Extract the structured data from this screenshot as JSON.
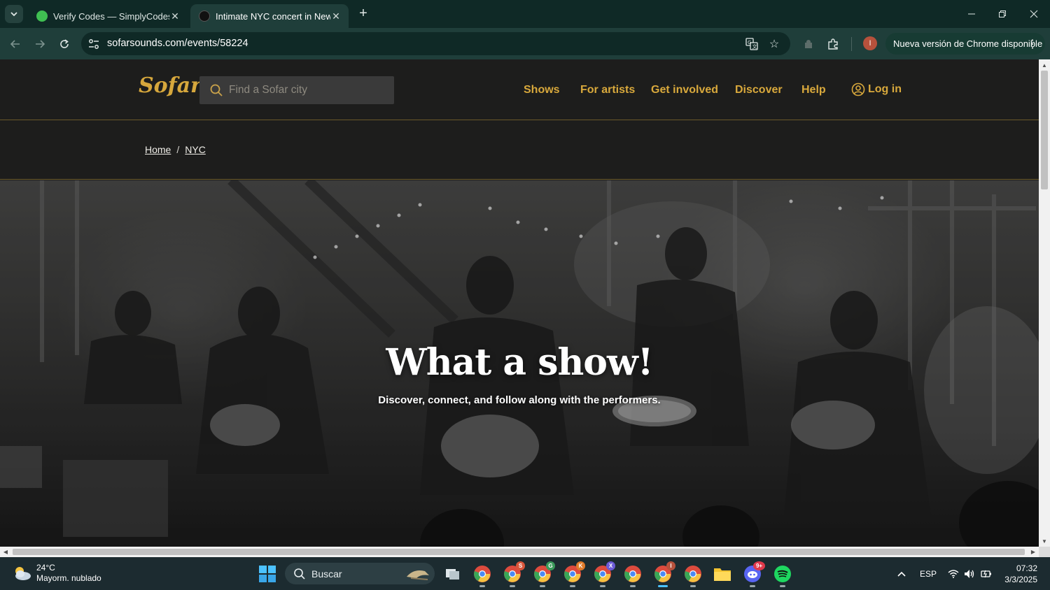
{
  "browser": {
    "tabs": [
      {
        "title": "Verify Codes — SimplyCodes",
        "active": false,
        "favicon_color": "#3fbf52"
      },
      {
        "title": "Intimate NYC concert in Newark",
        "active": true,
        "favicon_color": "#1a1a1a"
      }
    ],
    "url": "sofarsounds.com/events/58224",
    "profile_initial": "I",
    "update_label": "Nueva versión de Chrome disponible"
  },
  "site": {
    "logo": "Sofar",
    "search_placeholder": "Find a Sofar city",
    "nav": [
      "Shows",
      "For artists",
      "Get involved",
      "Discover",
      "Help"
    ],
    "login_label": "Log in",
    "accent_color": "#d9a93c"
  },
  "breadcrumb": {
    "home": "Home",
    "separator": "/",
    "city": "NYC"
  },
  "hero": {
    "title": "What a show!",
    "subtitle": "Discover, connect, and follow along with the performers."
  },
  "taskbar": {
    "weather_temp": "24°C",
    "weather_desc": "Mayorm. nublado",
    "search_label": "Buscar",
    "language": "ESP",
    "time": "07:32",
    "date": "3/3/2025",
    "apps": [
      {
        "name": "task-view",
        "badge": ""
      },
      {
        "name": "chrome-profile-1",
        "badge": ""
      },
      {
        "name": "chrome-profile-s",
        "badge": "S"
      },
      {
        "name": "chrome-profile-g",
        "badge": "G"
      },
      {
        "name": "chrome-profile-k",
        "badge": "K"
      },
      {
        "name": "chrome-profile-x",
        "badge": "X"
      },
      {
        "name": "chrome-profile-6",
        "badge": ""
      },
      {
        "name": "chrome-profile-i",
        "badge": "I"
      },
      {
        "name": "chrome-profile-8",
        "badge": ""
      },
      {
        "name": "file-explorer",
        "badge": ""
      },
      {
        "name": "discord",
        "badge": "9+"
      },
      {
        "name": "spotify",
        "badge": ""
      }
    ]
  }
}
